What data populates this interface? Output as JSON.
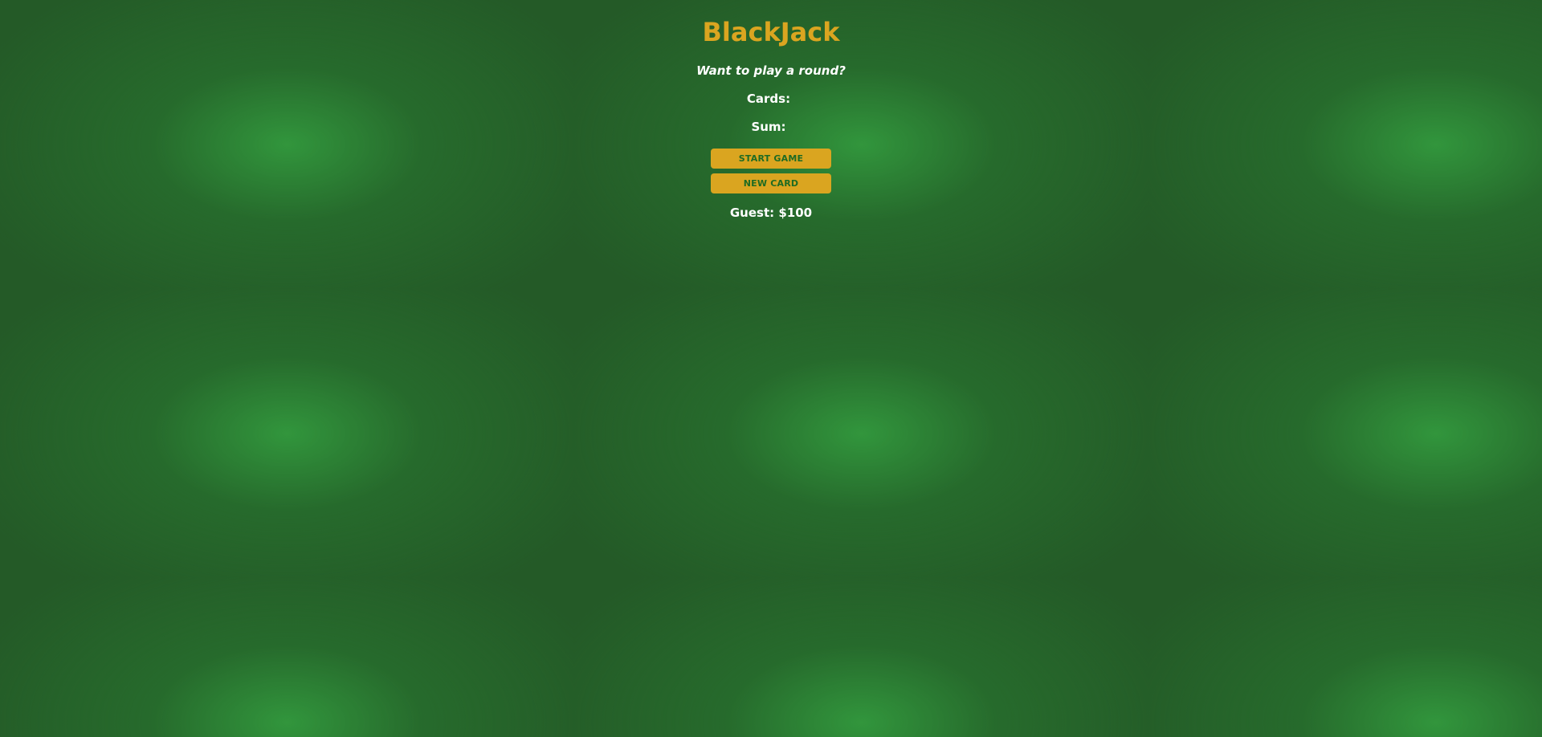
{
  "title": "BlackJack",
  "message": "Want to play a round?",
  "cards": {
    "label": "Cards:",
    "value": ""
  },
  "sum": {
    "label": "Sum:",
    "value": ""
  },
  "buttons": {
    "start_label": "START GAME",
    "new_card_label": "NEW CARD"
  },
  "player": "Guest: $100",
  "colors": {
    "felt": "#245a27",
    "felt_highlight": "#34a040",
    "accent": "#daa520",
    "button_text": "#1e6b23",
    "text": "#ffffff"
  }
}
